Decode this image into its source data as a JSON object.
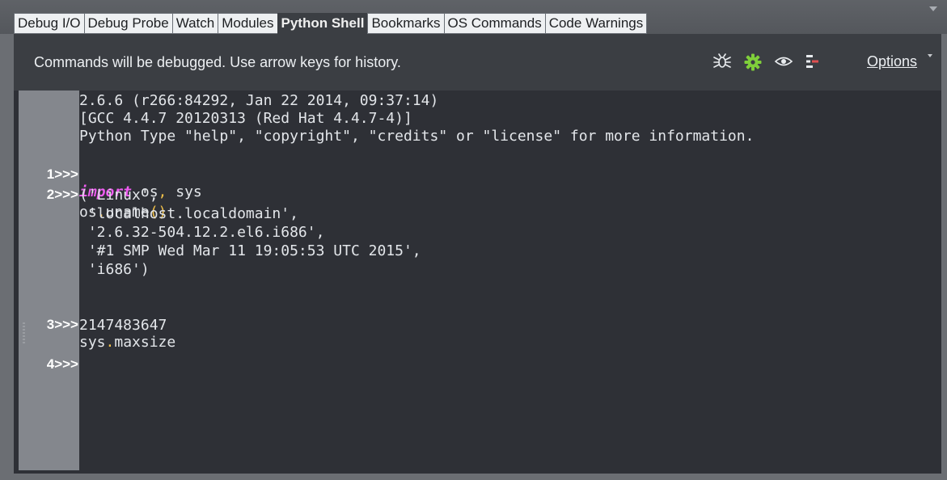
{
  "tabs": [
    {
      "label": "Debug I/O",
      "active": false
    },
    {
      "label": "Debug Probe",
      "active": false
    },
    {
      "label": "Watch",
      "active": false
    },
    {
      "label": "Modules",
      "active": false
    },
    {
      "label": "Python Shell",
      "active": true
    },
    {
      "label": "Bookmarks",
      "active": false
    },
    {
      "label": "OS Commands",
      "active": false
    },
    {
      "label": "Code Warnings",
      "active": false
    }
  ],
  "toolbar": {
    "message": "Commands will be debugged.  Use arrow keys for history.",
    "icons": [
      "bug-icon",
      "gear-icon",
      "eye-icon",
      "stack-icon"
    ],
    "options_label": "Options"
  },
  "shell": {
    "banner": [
      "2.6.6 (r266:84292, Jan 22 2014, 09:37:14)",
      "[GCC 4.4.7 20120313 (Red Hat 4.4.7-4)]",
      "Python Type \"help\", \"copyright\", \"credits\" or \"license\" for more information."
    ],
    "entries": [
      {
        "prompt": "1>>>",
        "keyword": "import",
        "rest": " os",
        "sep": ",",
        "tail": " sys"
      },
      {
        "prompt": "2>>>",
        "obj": "os",
        "dot": ".",
        "method": "uname",
        "parens": "()",
        "output": [
          "('Linux',",
          " 'localhost.localdomain',",
          " '2.6.32-504.12.2.el6.i686',",
          " '#1 SMP Wed Mar 11 19:05:53 UTC 2015',",
          " 'i686')"
        ]
      },
      {
        "prompt": "3>>>",
        "obj": "sys",
        "dot": ".",
        "attr": "maxsize",
        "output": [
          "2147483647"
        ]
      },
      {
        "prompt": "4>>>"
      }
    ]
  },
  "colors": {
    "background": "#3b3e43",
    "editor": "#2e3036",
    "gutter": "#84878d",
    "keyword": "#ee5cf0",
    "operator": "#f2c14a",
    "text": "#e3e6ea"
  }
}
